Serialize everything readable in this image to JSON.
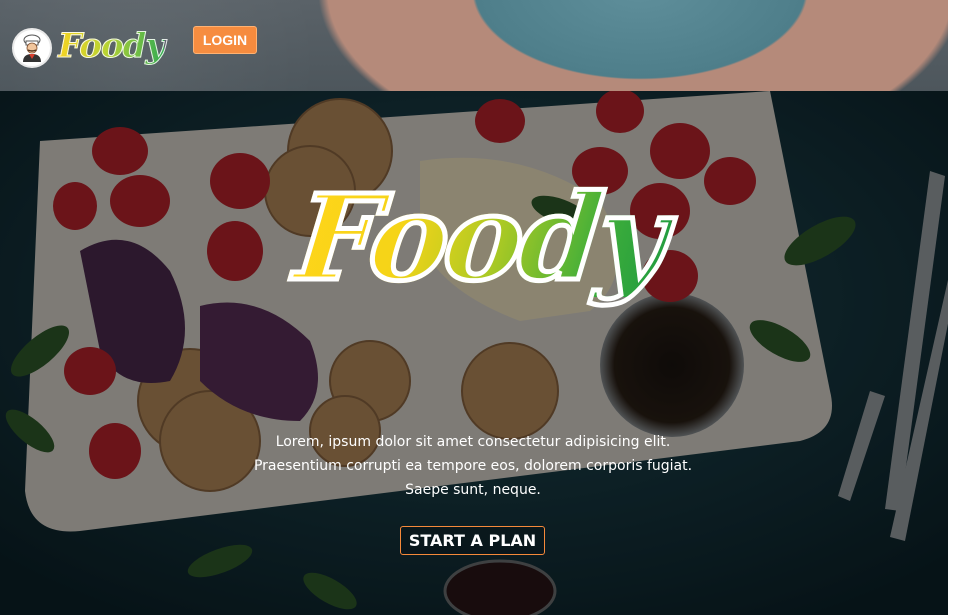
{
  "header": {
    "logo_text": "Foody",
    "logo_icon": "chef-icon",
    "login_label": "LOGIN"
  },
  "hero": {
    "title": "Foody",
    "description_lines": [
      "Lorem, ipsum dolor sit amet consectetur adipisicing elit.",
      "Praesentium corrupti ea tempore eos, dolorem corporis fugiat.",
      "Saepe sunt, neque."
    ],
    "cta_label": "START A PLAN"
  },
  "colors": {
    "accent": "#f6893a",
    "logo_gradient_start": "#f6d21d",
    "logo_gradient_end": "#2aa84a",
    "hero_background": "#0f2a33"
  }
}
